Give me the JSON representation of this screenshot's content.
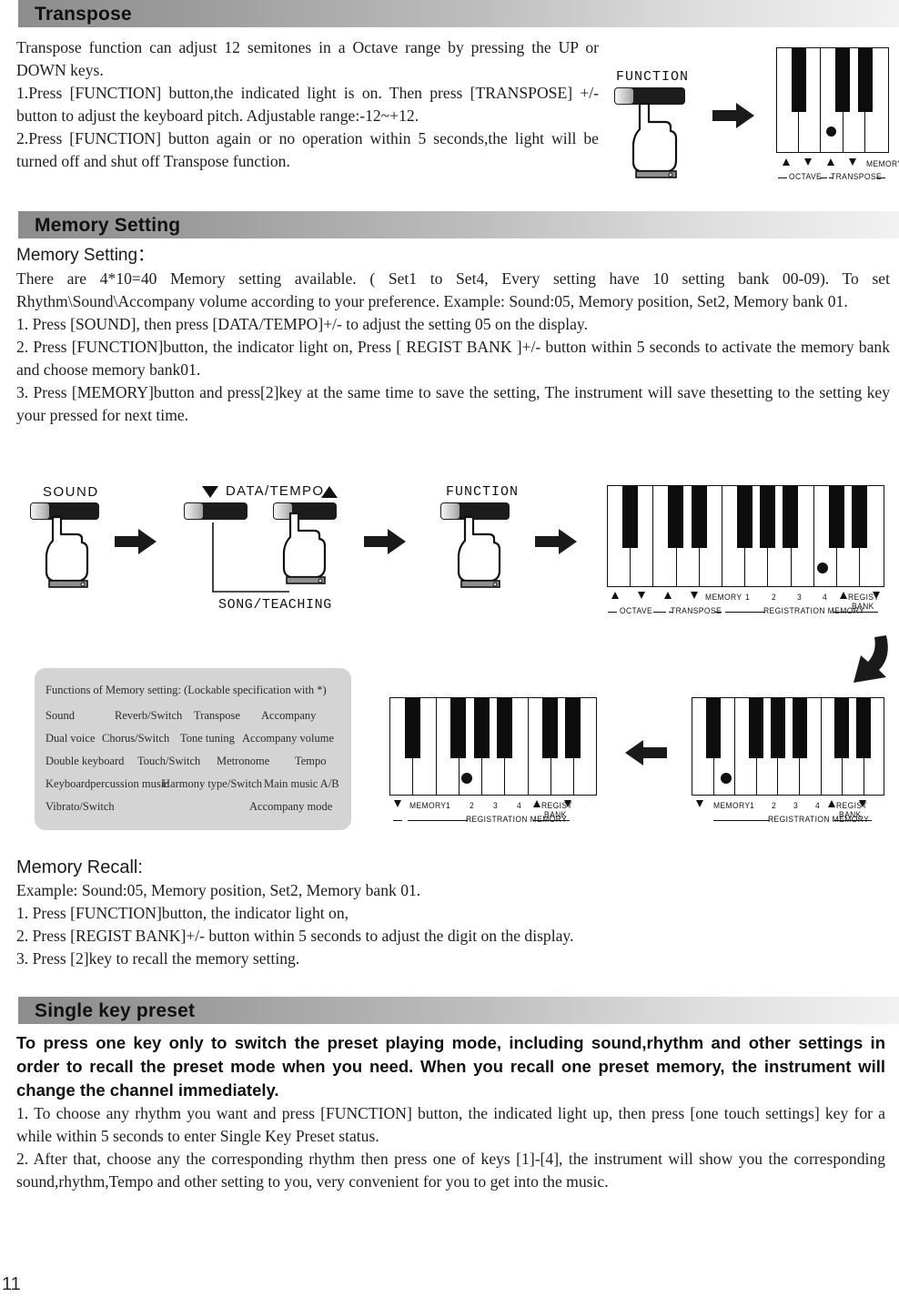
{
  "page": {
    "number": "11"
  },
  "sections": {
    "transpose": {
      "heading": "Transpose",
      "paragraphs": [
        "Transpose function can adjust 12 semitones in a Octave range by pressing the UP or DOWN keys.",
        "1.Press [FUNCTION] button,the indicated light is on. Then press [TRANSPOSE] +/- button to adjust the keyboard pitch. Adjustable range:-12~+12.",
        "2.Press [FUNCTION] button again or no operation within 5 seconds,the light will be turned off and shut off Transpose function."
      ],
      "diagram": {
        "button_label": "FUNCTION",
        "arrow": "arrow-right",
        "keyboard_labels": {
          "keys": [
            "▲",
            "▼",
            "▲",
            "▼",
            "MEMORY"
          ],
          "brackets": [
            "OCTAVE",
            "TRANSPOSE"
          ]
        }
      }
    },
    "memory_setting": {
      "heading": "Memory Setting",
      "sub_heading": "Memory Setting：",
      "paragraphs": [
        "There are 4*10=40 Memory setting available. ( Set1 to Set4, Every setting have 10 setting bank 00-09). To set Rhythm\\Sound\\Accompany volume according to your preference. Example: Sound:05, Memory position, Set2, Memory bank 01.",
        "1. Press [SOUND], then press [DATA/TEMPO]+/- to adjust the setting 05 on the display.",
        "2. Press [FUNCTION]button, the indicator light on, Press [ REGIST BANK ]+/- button within 5 seconds to activate the memory bank and choose memory bank01.",
        "3. Press [MEMORY]button and press[2]key at the same time to save the setting, The instrument will save thesetting to the setting key your pressed for next time."
      ],
      "diagram": {
        "sound_button": "SOUND",
        "data_tempo_label": "DATA/TEMPO",
        "song_teaching_label": "SONG/TEACHING",
        "function_button": "FUNCTION",
        "keyboard_labels": {
          "keys": [
            "▲",
            "▼",
            "▲",
            "▼",
            "MEMORY",
            "1",
            "2",
            "3",
            "4",
            "REGIST",
            "BANK"
          ],
          "brackets": [
            "OCTAVE",
            "TRANSPOSE",
            "REGISTRATION MEMORY"
          ]
        },
        "small_keyboard_labels": {
          "keys": [
            "▼",
            "MEMORY",
            "1",
            "2",
            "3",
            "4",
            "REGIST",
            "BANK"
          ],
          "brackets": [
            "REGISTRATION MEMORY"
          ]
        }
      },
      "functions_panel": {
        "title": "Functions of Memory setting: (Lockable specification with *)",
        "rows": [
          [
            "Sound",
            "Reverb/Switch",
            "Transpose",
            "Accompany"
          ],
          [
            "Dual voice",
            "Chorus/Switch",
            "Tone tuning",
            "Accompany volume"
          ],
          [
            "Double keyboard",
            "Touch/Switch",
            "Metronome",
            "Tempo"
          ],
          [
            "Keyboardpercussion music",
            "Harmony type/Switch",
            "Main music A/B",
            ""
          ],
          [
            "Vibrato/Switch",
            "",
            "Accompany mode",
            ""
          ]
        ]
      }
    },
    "memory_recall": {
      "heading": "Memory Recall:",
      "paragraphs": [
        "Example: Sound:05, Memory position, Set2, Memory bank 01.",
        "1. Press [FUNCTION]button, the indicator light on,",
        "2. Press [REGIST BANK]+/- button within 5 seconds to adjust the digit on the display.",
        "3. Press [2]key to recall the memory setting."
      ]
    },
    "single_key_preset": {
      "heading": "Single key preset",
      "bold_paragraph": "To press one key only to switch the preset playing mode, including sound,rhythm and other settings in order to recall the preset mode when you need. When you recall one preset memory, the instrument will change the channel immediately.",
      "paragraphs": [
        "1. To choose any rhythm you want and press [FUNCTION] button, the indicated light up, then press [one touch settings] key for a while within 5 seconds to enter Single Key Preset status.",
        "2. After that, choose any the corresponding rhythm then press one of keys [1]-[4], the instrument will show you the corresponding sound,rhythm,Tempo and other setting to you, very convenient for you to get into the music."
      ]
    }
  },
  "colors": {
    "header_gradient_start": "#8d8d8d",
    "header_gradient_end": "#f2f2f2",
    "panel_bg": "#d4d4d4",
    "ink": "#111111"
  }
}
